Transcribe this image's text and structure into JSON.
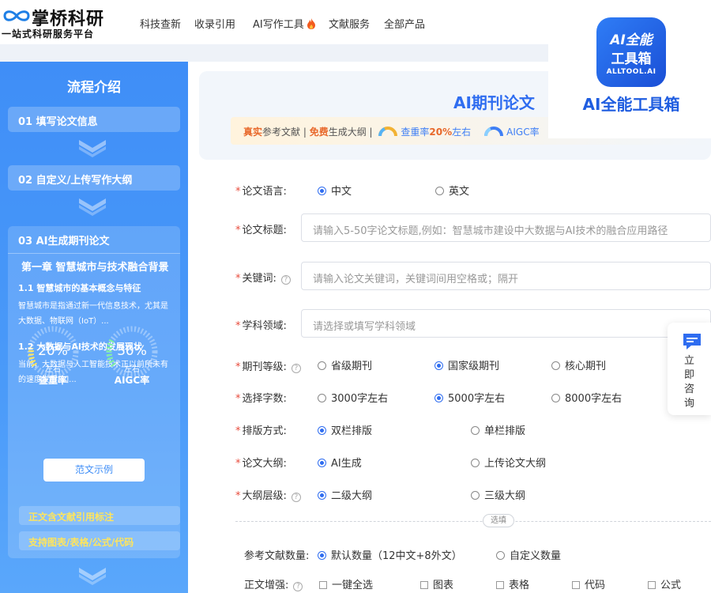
{
  "header": {
    "logo_name": "掌桥科研",
    "logo_slogan": "一站式科研服务平台",
    "nav": [
      "科技查新",
      "收录引用",
      "AI写作工具",
      "文献服务",
      "全部产品"
    ]
  },
  "ad": {
    "icon_line1": "AI全能",
    "icon_line2": "工具箱",
    "icon_line3": "ALLTOOL.AI",
    "title": "AI全能工具箱"
  },
  "sidebar": {
    "title": "流程介绍",
    "step1": "01 填写论文信息",
    "step2": "02 自定义/上传写作大纲",
    "step3": "03 AI生成期刊论文",
    "chapter_title": "第一章 智慧城市与技术融合背景",
    "sec1_title": "1.1 智慧城市的基本概念与特征",
    "sec1_text": "智慧城市是指通过新一代信息技术，尤其是大数据、物联网（IoT）...",
    "sec2_title": "1.2 大数据与AI技术的发展现状",
    "sec2_text": "当前，大数据与人工智能技术正以前所未有的速度发展[1]...",
    "example_button": "范文示例",
    "gauge1": {
      "value": "20%",
      "sub": "左右",
      "label": "查重率"
    },
    "gauge2": {
      "value": "30%",
      "sub": "左右",
      "label": "AIGC率"
    },
    "feature1": "正文含文献引用标注",
    "feature2": "支持图表/表格/公式/代码"
  },
  "banner": {
    "title": "AI期刊论文",
    "t1": "真实",
    "t2": "参考文献 | ",
    "t3": "免费",
    "t4": "生成大纲 | ",
    "t5": "查重率",
    "t6": "20%",
    "t7": "左右",
    "t8": "AIGC率"
  },
  "form": {
    "language": {
      "label": "论文语言:",
      "options": [
        "中文",
        "英文"
      ],
      "selected": "中文"
    },
    "title": {
      "label": "论文标题:",
      "placeholder": "请输入5-50字论文标题,例如：智慧城市建设中大数据与AI技术的融合应用路径"
    },
    "keywords": {
      "label": "关键词:",
      "placeholder": "请输入论文关键词，关键词间用空格或；隔开"
    },
    "field": {
      "label": "学科领域:",
      "placeholder": "请选择或填写学科领域"
    },
    "level": {
      "label": "期刊等级:",
      "options": [
        "省级期刊",
        "国家级期刊",
        "核心期刊"
      ],
      "selected": "国家级期刊"
    },
    "words": {
      "label": "选择字数:",
      "options": [
        "3000字左右",
        "5000字左右",
        "8000字左右"
      ],
      "selected": "5000字左右"
    },
    "layout": {
      "label": "排版方式:",
      "options": [
        "双栏排版",
        "单栏排版"
      ],
      "selected": "双栏排版"
    },
    "outline": {
      "label": "论文大纲:",
      "options": [
        "AI生成",
        "上传论文大纲"
      ],
      "selected": "AI生成"
    },
    "outline_level": {
      "label": "大纲层级:",
      "options": [
        "二级大纲",
        "三级大纲"
      ],
      "selected": "二级大纲"
    },
    "divider_label": "选填",
    "refs": {
      "label": "参考文献数量:",
      "options": [
        "默认数量（12中文+8外文）",
        "自定义数量"
      ],
      "selected": "默认数量（12中文+8外文）"
    },
    "enhance": {
      "label": "正文增强:",
      "options": [
        "一键全选",
        "图表",
        "表格",
        "代码",
        "公式"
      ]
    }
  },
  "consult": {
    "text": [
      "立",
      "即",
      "咨",
      "询"
    ]
  },
  "colors": {
    "primary": "#2f6df0",
    "sidebar": "#4a9af9",
    "accent_orange": "#e8692c",
    "feature_yellow": "#ffe55c"
  }
}
